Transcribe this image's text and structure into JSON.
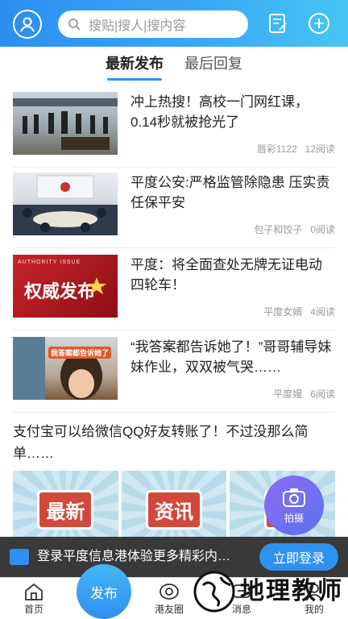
{
  "header": {
    "search_placeholder": "搜贴|搜人|搜内容"
  },
  "tabs": [
    {
      "label": "最新发布",
      "active": true
    },
    {
      "label": "最后回复",
      "active": false
    }
  ],
  "news": [
    {
      "title": "冲上热搜！高校一门网红课，0.14秒就被抢光了",
      "author": "唇彩1122",
      "reads": "12阅读"
    },
    {
      "title": "平度公安:严格监管除隐患 压实责任保平安",
      "author": "包子和饺子",
      "reads": "0阅读"
    },
    {
      "title": "平度：将全面查处无牌无证电动四轮车！",
      "author": "平度女婿",
      "reads": "4阅读",
      "thumb_tag": "AUTHORITY ISSUE",
      "thumb_text": "权威发布"
    },
    {
      "title": "“我答案都告诉她了！”哥哥辅导妹妹作业，双双被气哭……",
      "author": "平度嫚",
      "reads": "6阅读",
      "thumb_text": "我答案都告诉她了"
    }
  ],
  "post": {
    "title": "支付宝可以给微信QQ好友转账了！不过没那么简单……",
    "banners": [
      "最新",
      "资讯",
      "速"
    ]
  },
  "fab": {
    "label": "拍摄"
  },
  "login": {
    "text": "登录平度信息港体验更多精彩内…",
    "button": "立即登录"
  },
  "nav": {
    "home": "首页",
    "publish": "发布",
    "circle": "港友圈",
    "messages": "消息",
    "mine": "我的"
  },
  "watermark": {
    "text": "地理教师"
  },
  "colors": {
    "accent": "#2f92ee",
    "header_start": "#2c8ff0",
    "header_end": "#45c6f2"
  }
}
